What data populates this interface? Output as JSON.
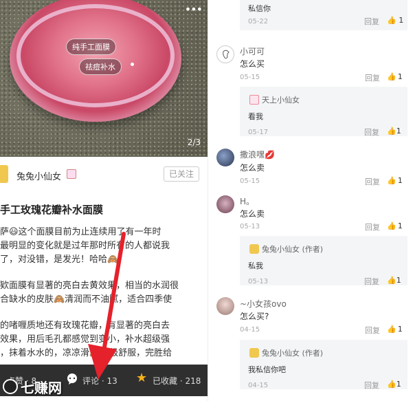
{
  "photo": {
    "tags": [
      "纯手工面膜",
      "祛痘补水"
    ],
    "page_indicator": "2/3"
  },
  "author": {
    "name": "兔兔小仙女",
    "follow_label": "已关注"
  },
  "post": {
    "title": "手工玫瑰花瓣补水面膜",
    "body_lines": [
      "萨😃这个面膜目前为止连续用了有一年时",
      "最明显的变化就是过年那时所有的人都说我",
      "了，对没错，是发光！哈哈🙈",
      "",
      "欵面膜有显著的亮白去黄效果，相当的水润很",
      "合缺水的皮肤🙈清润而不油腻，适合四季使",
      "",
      "的啫喱质地还有玫瑰花瓣，有显著的亮白去",
      "效果，用后毛孔都感觉到变小，补水超级强",
      "，抹着水水的，凉凉滑🙈超级舒服，完胜给"
    ]
  },
  "bottom_bar": {
    "like_label": "点赞",
    "like_count": "8",
    "comment_label": "评论",
    "comment_count": "13",
    "collect_label": "已收藏",
    "collect_count": "218"
  },
  "watermark": "七赚网",
  "comments": {
    "reply_label": "回复",
    "top": {
      "text": "私信你",
      "date": "05-22",
      "likes": "1"
    },
    "items": [
      {
        "name": "小可可",
        "text": "怎么买",
        "date": "05-15",
        "likes": "1",
        "sub": {
          "name": "天上小仙女",
          "text": "看我",
          "date": "05-17",
          "likes": "1"
        }
      },
      {
        "name": "撒浪嘿💋",
        "text": "怎么卖",
        "date": "05-15",
        "likes": "1"
      },
      {
        "name": "H。",
        "text": "怎么卖",
        "date": "05-13",
        "likes": "1",
        "sub": {
          "name": "兔兔小仙女 (作者)",
          "text": "私我",
          "date": "05-13",
          "likes": "1"
        }
      },
      {
        "name": "~小女孩ovo",
        "text": "怎么买?",
        "date": "04-15",
        "likes": "1",
        "sub": {
          "name": "兔兔小仙女 (作者)",
          "text": "我私信你吧",
          "date": "04-15",
          "likes": "1"
        }
      }
    ]
  },
  "colors": {
    "accent": "#e04455",
    "bar": "#2f2f2f",
    "arrow": "#e5212b"
  }
}
